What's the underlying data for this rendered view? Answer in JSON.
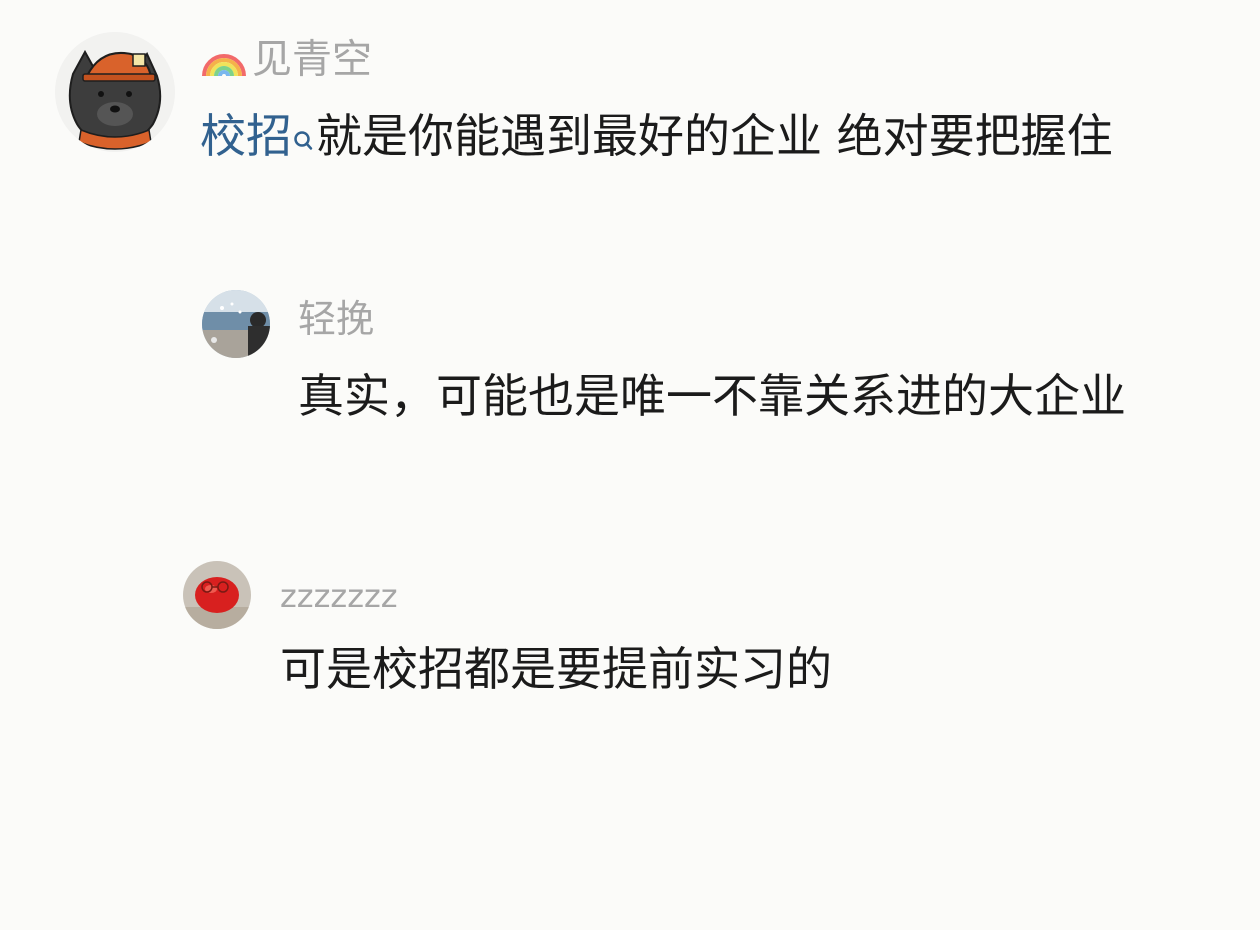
{
  "comments": [
    {
      "username": "见青空",
      "username_icon": "rainbow-icon",
      "avatar": "cartoon-cat-with-hardhat",
      "link_text": "校招",
      "link_icon": "search-icon",
      "link_color": "#31618f",
      "text": "就是你能遇到最好的企业 绝对要把握住"
    },
    {
      "username": "轻挽",
      "avatar": "seaside-photo",
      "text": "真实，可能也是唯一不靠关系进的大企业"
    },
    {
      "username": "zzzzzzz",
      "avatar": "red-fruit-photo",
      "text": "可是校招都是要提前实习的"
    }
  ],
  "colors": {
    "background": "#fbfbf9",
    "username": "#a6a6a6",
    "text": "#1b1b1b",
    "link": "#31618f"
  }
}
